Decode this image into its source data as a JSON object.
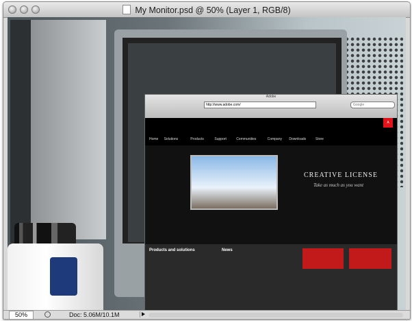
{
  "window": {
    "title": "My Monitor.psd @ 50% (Layer 1, RGB/8)"
  },
  "status_bar": {
    "zoom": "50%",
    "doc_info": "Doc: 5.06M/10.1M"
  },
  "embedded_browser": {
    "window_title": "Adobe",
    "address": "http://www.adobe.com/",
    "search_placeholder": "Google",
    "nav": [
      "Home",
      "Solutions",
      "Products",
      "Support",
      "Communities",
      "Company",
      "Downloads",
      "Store"
    ],
    "headline": "CREATIVE LICENSE",
    "tagline": "Take as much as you want",
    "products_heading": "Products and solutions",
    "news_heading": "News"
  }
}
